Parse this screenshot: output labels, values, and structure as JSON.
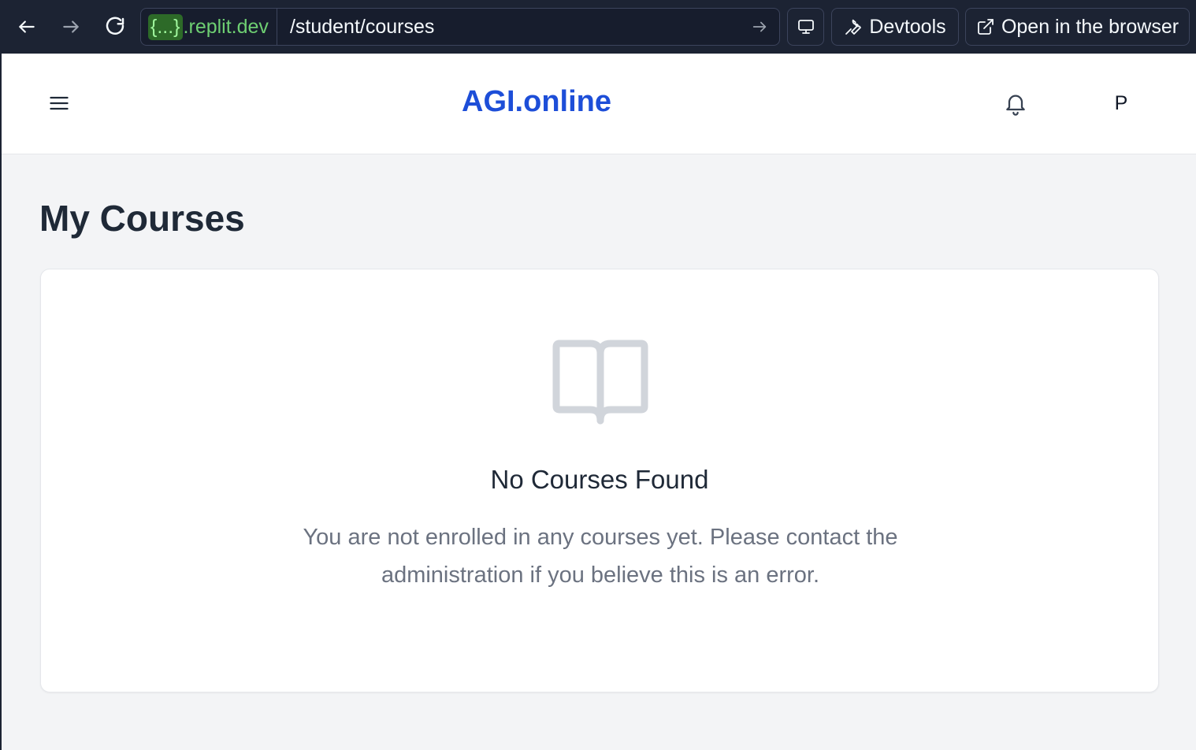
{
  "browser": {
    "domain_badge": "{...}",
    "domain_suffix": ".replit.dev",
    "path": "/student/courses",
    "devtools_label": "Devtools",
    "open_label": "Open in the browser"
  },
  "header": {
    "brand": "AGI.online",
    "avatar_initial": "P"
  },
  "main": {
    "title": "My Courses",
    "empty_state": {
      "icon": "book-open-icon",
      "title": "No Courses Found",
      "message": "You are not enrolled in any courses yet. Please contact the administration if you believe this is an error."
    }
  },
  "colors": {
    "brand": "#1d4ed8",
    "toolbar_bg": "#1c2333",
    "page_bg": "#f3f4f6",
    "muted_text": "#6b7280",
    "icon_gray": "#d1d5db"
  }
}
